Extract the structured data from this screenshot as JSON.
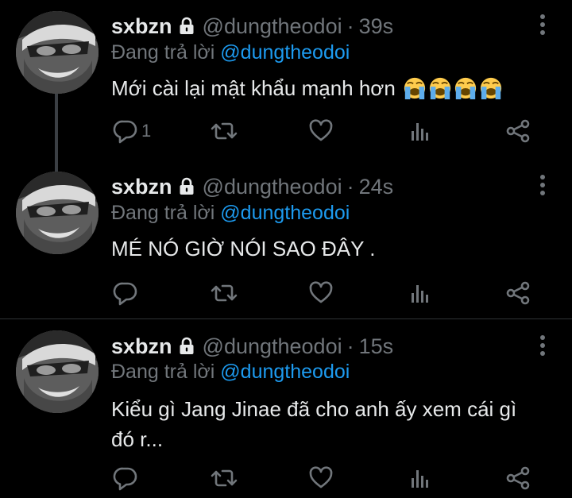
{
  "tweets": [
    {
      "name": "sxbzn",
      "handle": "@dungtheodoi",
      "separator": "·",
      "time": "39s",
      "reply_prefix": "Đang trả lời",
      "reply_to": "@dungtheodoi",
      "text": "Mới cài lại mật khẩu mạnh hơn",
      "emoji_count": 4,
      "reply_count": "1"
    },
    {
      "name": "sxbzn",
      "handle": "@dungtheodoi",
      "separator": "·",
      "time": "24s",
      "reply_prefix": "Đang trả lời",
      "reply_to": "@dungtheodoi",
      "text": "MÉ NÓ GIỜ NÓI SAO ĐÂY .",
      "reply_count": ""
    },
    {
      "name": "sxbzn",
      "handle": "@dungtheodoi",
      "separator": "·",
      "time": "15s",
      "reply_prefix": "Đang trả lời",
      "reply_to": "@dungtheodoi",
      "text_line1": "Kiểu gì Jang Jinae đã cho anh ấy xem cái gì",
      "text_line2": "đó r...",
      "reply_count": ""
    }
  ],
  "colors": {
    "background": "#000000",
    "text": "#e7e9ea",
    "muted": "#71767b",
    "accent": "#1d9bf0",
    "divider": "#2f3336"
  },
  "icons": [
    "lock-icon",
    "more-icon",
    "reply-icon",
    "retweet-icon",
    "like-icon",
    "views-icon",
    "share-icon",
    "loudly-crying-face-emoji"
  ]
}
